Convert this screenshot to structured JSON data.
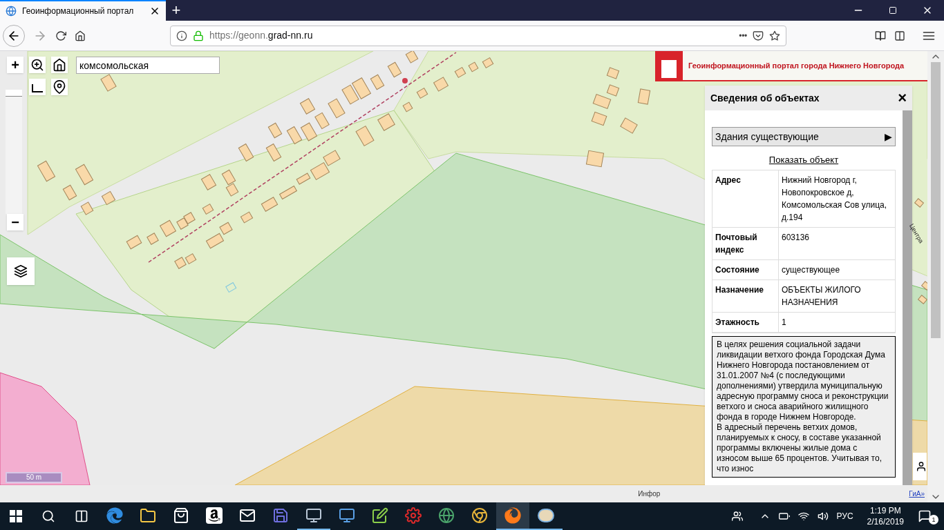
{
  "browser": {
    "tab_title": "Геоинформационный портал",
    "new_tab": "+",
    "url_scheme": "https://geonn.",
    "url_domain": "grad-nn.ru",
    "page_actions": "•••"
  },
  "banner": {
    "title": "Геоинформационный портал города Нижнего Новгорода"
  },
  "map": {
    "search_value": "комсомольская",
    "zoom_in": "+",
    "zoom_out": "−",
    "zoom": {
      "level": 1.0
    },
    "scale": "50 m",
    "street_label": "Центра",
    "attribution": "Инфор",
    "attribution_link": "ГиА»"
  },
  "info_panel": {
    "title": "Сведения об объектах",
    "close": "×",
    "layer": {
      "label": "Здания существующие",
      "toggle": "▶"
    },
    "show_link": "Показать объект",
    "properties": [
      {
        "label": "Адрес",
        "value": "Нижний Новгород г, Новопокровское д, Комсомольская Сов улица, д.194"
      },
      {
        "label": "Почтовый индекс",
        "value": "603136"
      },
      {
        "label": "Состояние",
        "value": "существующее"
      },
      {
        "label": "Назначение",
        "value": "ОБЪЕКТЫ ЖИЛОГО НАЗНАЧЕНИЯ"
      },
      {
        "label": "Этажность",
        "value": "1"
      }
    ],
    "description": [
      "В целях решения социальной задачи ликвидации ветхого фонда Городская Дума Нижнего Новгорода постановлением от 31.01.2007 №4 (с последующими дополнениями) утвердила муниципальную адресную программу сноса и реконструкции ветхого и сноса аварийного жилищного фонда в городе Нижнем Новгороде.",
      "В адресный перечень ветхих домов, планируемых к сносу, в составе указанной программы включены жилые дома с износом выше 65 процентов. Учитывая то, что износ"
    ]
  },
  "taskbar": {
    "apps": [
      {
        "kind": "edge",
        "running": false,
        "active": false
      },
      {
        "kind": "folder",
        "running": false,
        "active": false
      },
      {
        "kind": "store",
        "running": false,
        "active": false
      },
      {
        "kind": "amazon",
        "running": false,
        "active": false
      },
      {
        "kind": "mail",
        "running": false,
        "active": false
      },
      {
        "kind": "floppy",
        "running": false,
        "active": false
      },
      {
        "kind": "monitor",
        "running": true,
        "active": false
      },
      {
        "kind": "remote",
        "running": false,
        "active": false
      },
      {
        "kind": "notepad",
        "running": false,
        "active": false
      },
      {
        "kind": "gear",
        "running": false,
        "active": false
      },
      {
        "kind": "globe",
        "running": false,
        "active": false
      },
      {
        "kind": "chrome",
        "running": false,
        "active": false
      },
      {
        "kind": "firefox",
        "running": true,
        "active": true
      },
      {
        "kind": "paint",
        "running": true,
        "active": false
      }
    ],
    "language": "РУС",
    "time": "1:19 PM",
    "date": "2/16/2019",
    "notifications": "1"
  }
}
